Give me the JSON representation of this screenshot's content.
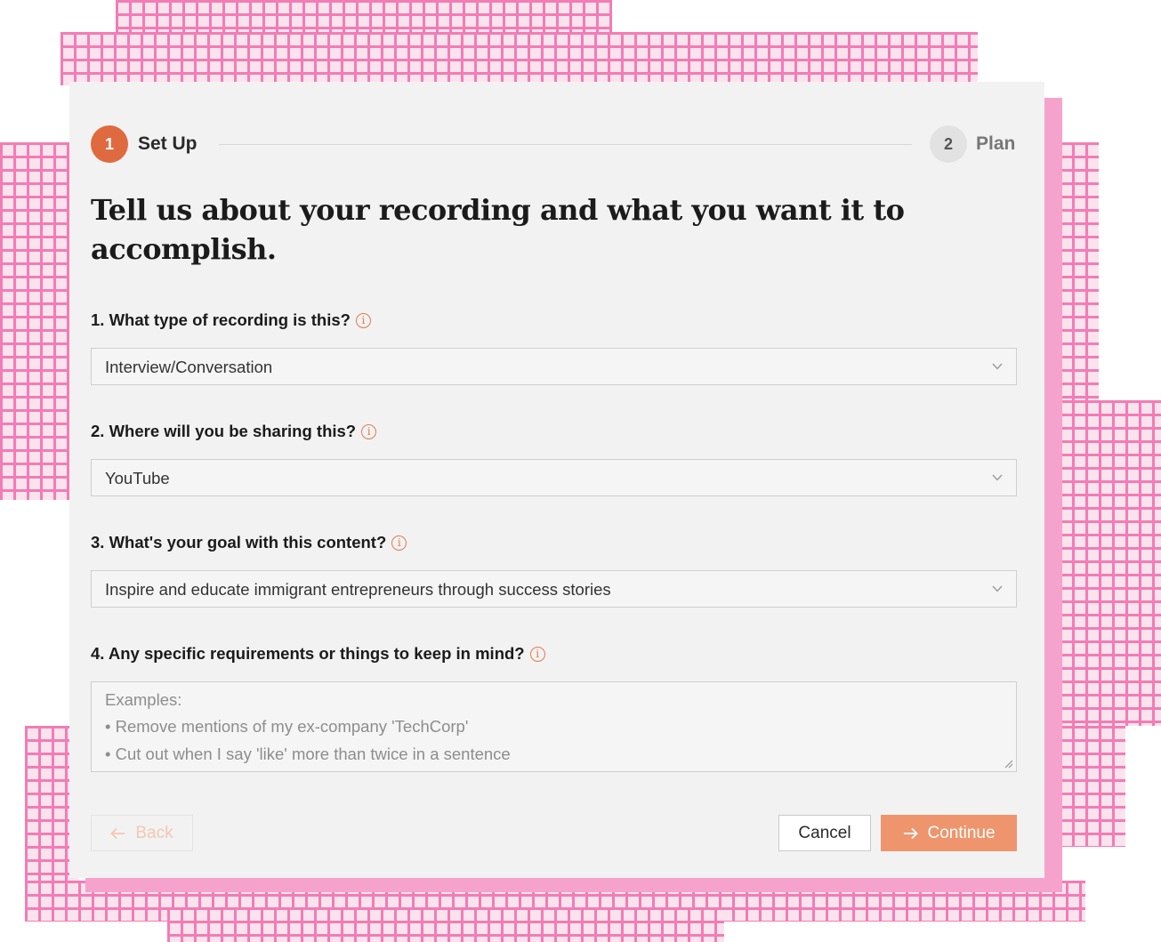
{
  "stepper": {
    "steps": [
      {
        "number": "1",
        "label": "Set Up",
        "state": "active"
      },
      {
        "number": "2",
        "label": "Plan",
        "state": "inactive"
      }
    ]
  },
  "heading": "Tell us about your recording and what you want it to accomplish.",
  "questions": [
    {
      "label": "1. What type of recording is this?",
      "value": "Interview/Conversation"
    },
    {
      "label": "2. Where will you be sharing this?",
      "value": "YouTube"
    },
    {
      "label": "3. What's your goal with this content?",
      "value": "Inspire and educate immigrant entrepreneurs through success stories"
    },
    {
      "label": "4. Any specific requirements or things to keep in mind?",
      "placeholder_lines": [
        "Examples:",
        "• Remove mentions of my ex-company 'TechCorp'",
        "• Cut out when I say 'like' more than twice in a sentence"
      ]
    }
  ],
  "buttons": {
    "back": "Back",
    "cancel": "Cancel",
    "continue": "Continue"
  },
  "icons": {
    "info": "info-icon",
    "chevron": "chevron-down-icon",
    "back": "arrow-left-icon",
    "continue": "arrow-right-icon"
  },
  "colors": {
    "accent": "#e06a3f",
    "continue_bg": "#ef956d",
    "pattern": "#f37cb4",
    "pattern_bg": "#fbe3ee"
  }
}
